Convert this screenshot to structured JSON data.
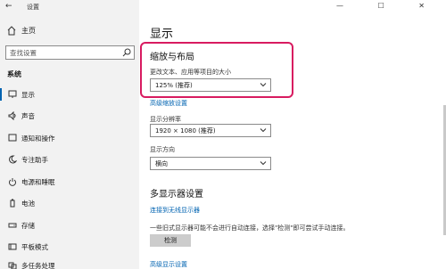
{
  "window": {
    "title": "设置",
    "back": "←",
    "controls": "— ☐ ✕"
  },
  "sidebar": {
    "home_label": "主页",
    "search_placeholder": "查找设置",
    "section": "系统",
    "items": [
      {
        "label": "显示",
        "icon": "monitor-icon",
        "active": true
      },
      {
        "label": "声音",
        "icon": "speaker-icon"
      },
      {
        "label": "通知和操作",
        "icon": "notification-icon"
      },
      {
        "label": "专注助手",
        "icon": "moon-icon"
      },
      {
        "label": "电源和睡眠",
        "icon": "power-icon"
      },
      {
        "label": "电池",
        "icon": "battery-icon"
      },
      {
        "label": "存储",
        "icon": "storage-icon"
      },
      {
        "label": "平板模式",
        "icon": "tablet-icon"
      },
      {
        "label": "多任务处理",
        "icon": "multitask-icon"
      }
    ]
  },
  "main": {
    "page_title": "显示",
    "scale_section": {
      "heading": "缩放与布局",
      "size_label": "更改文本、应用等项目的大小",
      "size_value": "125% (推荐)",
      "advanced_link": "高级缩放设置",
      "resolution_label": "显示分辨率",
      "resolution_value": "1920 × 1080 (推荐)",
      "orientation_label": "显示方向",
      "orientation_value": "横向"
    },
    "multi_display": {
      "heading": "多显示器设置",
      "wireless_link": "连接到无线显示器",
      "description": "一些旧式显示器可能不会进行自动连接，选择\"检测\"即可尝试手动连接。",
      "detect_button": "检测",
      "advanced_link": "高级显示设置"
    }
  },
  "colors": {
    "accent": "#0063b1",
    "highlight": "#d81b60",
    "sidebar_bg": "#f2f2f2"
  }
}
